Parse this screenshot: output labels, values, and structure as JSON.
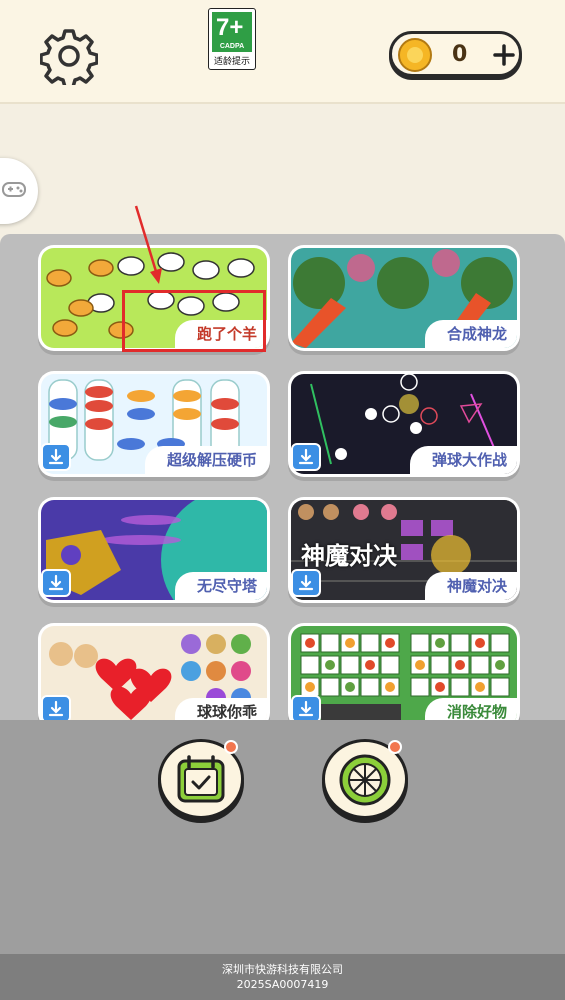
{
  "header": {
    "age_rating": {
      "number": "7+",
      "org": "CADPA",
      "note": "适龄提示"
    },
    "coins": "0"
  },
  "games": [
    {
      "name": "跑了个羊",
      "has_download": false
    },
    {
      "name": "合成神龙",
      "has_download": false
    },
    {
      "name": "超级解压硬币",
      "has_download": true
    },
    {
      "name": "弹球大作战",
      "has_download": true
    },
    {
      "name": "无尽守塔",
      "has_download": true
    },
    {
      "name": "神魔对决",
      "has_download": true,
      "art_title": "神魔对决"
    },
    {
      "name": "球球你乖",
      "has_download": true
    },
    {
      "name": "消除好物",
      "has_download": true
    }
  ],
  "footer": {
    "company": "深圳市快游科技有限公司",
    "license": "2025SA0007419"
  },
  "colors": {
    "label_purple": "#5060b0",
    "highlight_red": "#e12b2b",
    "download_blue": "#3c8fe4",
    "accent_green": "#8ccf3a",
    "coin_gold": "#f5b625"
  },
  "icons": [
    "gear-icon",
    "coin-icon",
    "plus-icon",
    "gamepad-icon",
    "download-icon",
    "calendar-icon",
    "lime-wheel-icon",
    "red-arrow-icon"
  ]
}
